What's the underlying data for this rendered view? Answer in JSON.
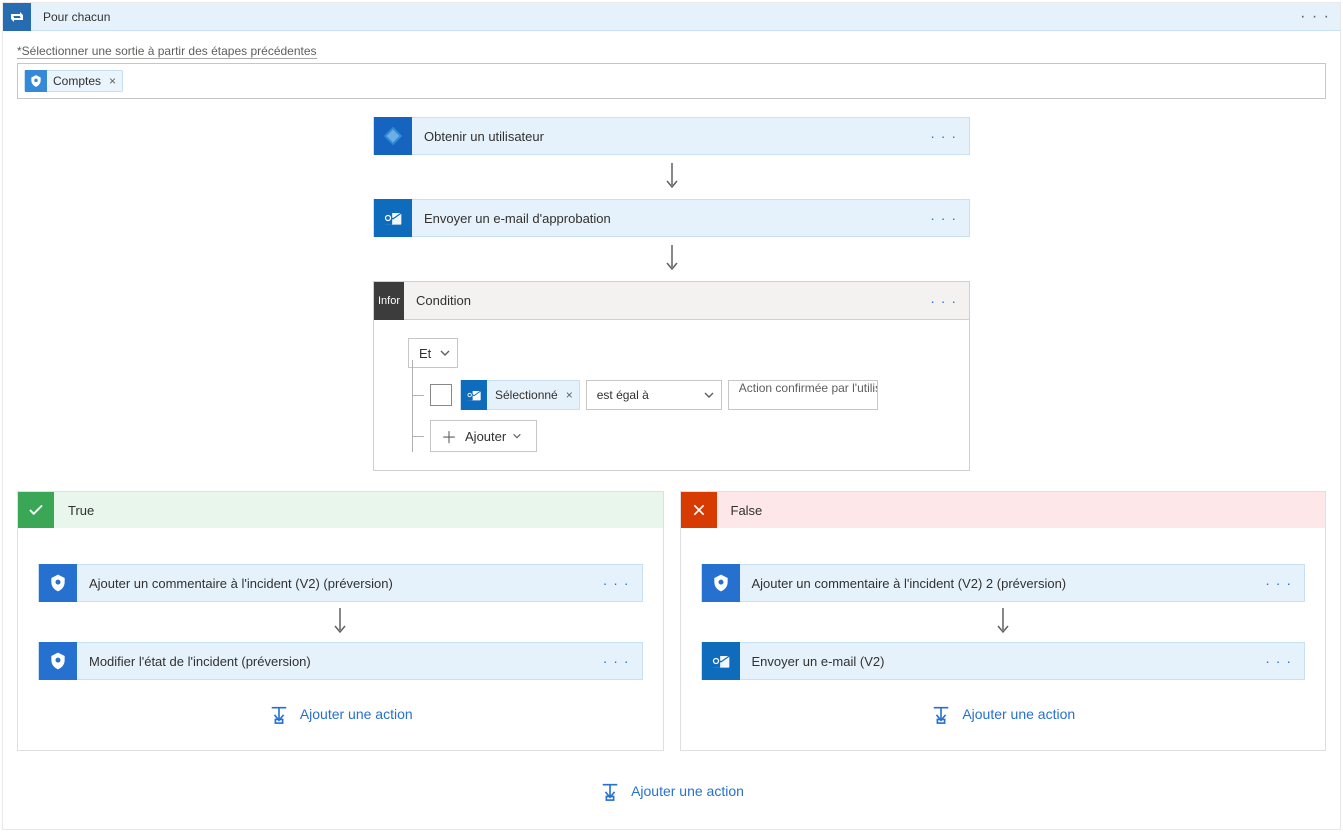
{
  "foreach": {
    "title": "Pour chacun",
    "selectOutputLabel": "*Sélectionner une sortie à partir des étapes précédentes",
    "token": {
      "label": "Comptes",
      "close": "×"
    }
  },
  "steps": {
    "getUser": "Obtenir un utilisateur",
    "sendApproval": "Envoyer un e-mail d'approbation"
  },
  "condition": {
    "tag": "Infor",
    "title": "Condition",
    "and": "Et",
    "selectedPill": "Sélectionné",
    "operator": "est égal à",
    "value": "Action confirmée par l'utilisateur",
    "addRule": "Ajouter"
  },
  "branches": {
    "true": {
      "title": "True",
      "steps": [
        "Ajouter un commentaire à l'incident (V2) (préversion)",
        "Modifier l'état de l'incident (préversion)"
      ],
      "addAction": "Ajouter une action"
    },
    "false": {
      "title": "False",
      "steps": [
        "Ajouter un commentaire à l'incident (V2) 2 (préversion)",
        "Envoyer un e-mail (V2)"
      ],
      "addAction": "Ajouter une action"
    }
  },
  "bottomAddAction": "Ajouter une action",
  "glyph": {
    "ellipsis": "· · ·",
    "close": "×"
  }
}
